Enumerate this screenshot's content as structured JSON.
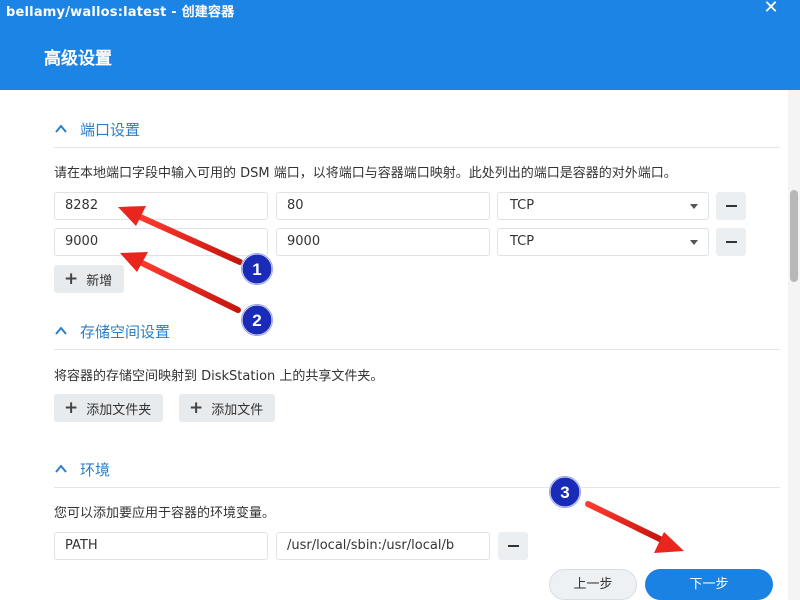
{
  "window": {
    "title": "bellamy/wallos:latest - 创建容器",
    "close_symbol": "✕"
  },
  "dialog": {
    "title": "高级设置"
  },
  "ports": {
    "heading": "端口设置",
    "description": "请在本地端口字段中输入可用的 DSM 端口，以将端口与容器端口映射。此处列出的端口是容器的对外端口。",
    "rows": [
      {
        "local_port": "8282",
        "container_port": "80",
        "protocol": "TCP"
      },
      {
        "local_port": "9000",
        "container_port": "9000",
        "protocol": "TCP"
      }
    ],
    "add_label": "新增"
  },
  "storage": {
    "heading": "存储空间设置",
    "description": "将容器的存储空间映射到 DiskStation 上的共享文件夹。",
    "add_folder_label": "添加文件夹",
    "add_file_label": "添加文件"
  },
  "environment": {
    "heading": "环境",
    "description": "您可以添加要应用于容器的环境变量。",
    "rows": [
      {
        "name": "PATH",
        "value": "/usr/local/sbin:/usr/local/b"
      }
    ]
  },
  "footer": {
    "prev_label": "上一步",
    "next_label": "下一步"
  },
  "annotations": {
    "markers": [
      "1",
      "2",
      "3"
    ],
    "color": "#e8261d",
    "marker_color": "#1a2bb8"
  },
  "colors": {
    "header_blue": "#1c84e4",
    "section_blue": "#2b7fc6",
    "primary_button": "#1a82e2"
  }
}
